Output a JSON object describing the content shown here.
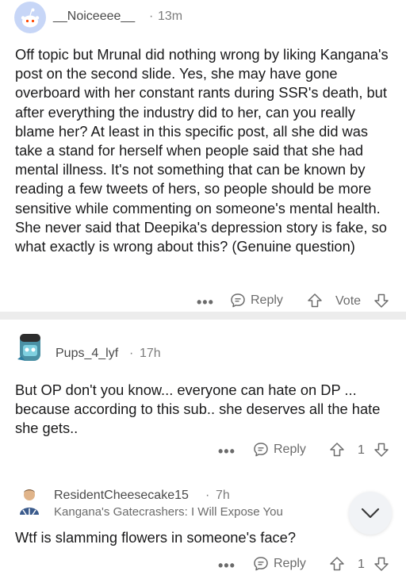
{
  "comments": [
    {
      "username": "__Noiceeee__",
      "time": "13m",
      "body": "Off topic but Mrunal did nothing wrong by liking Kangana's post on the second slide. Yes, she may have gone overboard with her constant rants during SSR's death, but after everything the industry did to her, can you really blame her? At least in this specific post, all she did was take a stand for herself when people said that she had mental illness. It's not something that can be known by reading a few tweets of hers, so people should be more sensitive while commenting on someone's mental health. She never said that Deepika's depression story is fake, so what exactly is wrong about this? (Genuine question)",
      "reply_label": "Reply",
      "vote_label": "Vote"
    },
    {
      "username": "Pups_4_lyf",
      "time": "17h",
      "body": "But OP don't you know... everyone can hate on DP ... because according to this sub.. she deserves all the hate she gets..",
      "reply_label": "Reply",
      "vote_label": "1"
    },
    {
      "username": "ResidentCheesecake15",
      "time": "7h",
      "flair": "Kangana's Gatecrashers: I Will Expose You",
      "body": "Wtf is slamming flowers in someone's face?",
      "reply_label": "Reply",
      "vote_label": "1"
    }
  ],
  "more_label": "•••",
  "dot": "·",
  "colors": {
    "background": "#ffffff",
    "separator": "#ececec",
    "text": "#1a1a1b",
    "meta": "#7c7c7c",
    "avatar1": "#c7d6f7"
  }
}
